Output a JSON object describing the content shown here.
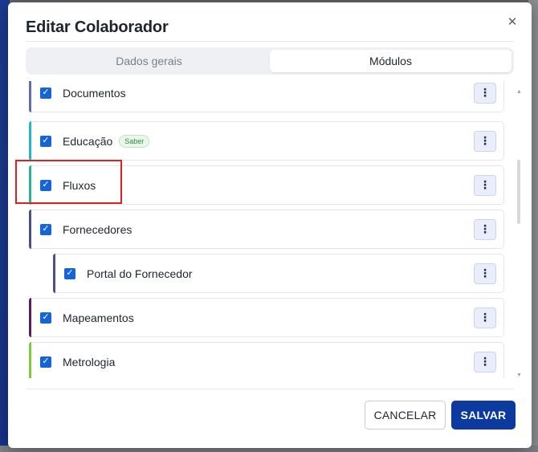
{
  "modal": {
    "title": "Editar Colaborador",
    "close_glyph": "✕"
  },
  "tabs": [
    {
      "label": "Dados gerais",
      "active": false
    },
    {
      "label": "Módulos",
      "active": true
    }
  ],
  "modules": [
    {
      "label": "Documentos",
      "checked": true,
      "accent": "#5b6fae",
      "tag": ""
    },
    {
      "label": "Educação",
      "checked": true,
      "accent": "#1fb8c9",
      "tag": "Saber"
    },
    {
      "label": "Fluxos",
      "checked": true,
      "accent": "#26b29a",
      "tag": ""
    },
    {
      "label": "Fornecedores",
      "checked": true,
      "accent": "#4a4f8c",
      "tag": ""
    },
    {
      "label": "Portal do Fornecedor",
      "checked": true,
      "accent": "#4a4f8c",
      "tag": ""
    },
    {
      "label": "Mapeamentos",
      "checked": true,
      "accent": "#5a1e5c",
      "tag": ""
    },
    {
      "label": "Metrologia",
      "checked": true,
      "accent": "#7ccf3b",
      "tag": ""
    }
  ],
  "icons": {
    "checkbox": "✓",
    "kebab": "⋮",
    "scroll_up": "▲",
    "scroll_down": "▼"
  },
  "footer": {
    "cancel_label": "CANCELAR",
    "save_label": "SALVAR"
  },
  "colors": {
    "primary": "#0d3a9e",
    "checkbox": "#1565d8",
    "highlight": "#e32020"
  }
}
